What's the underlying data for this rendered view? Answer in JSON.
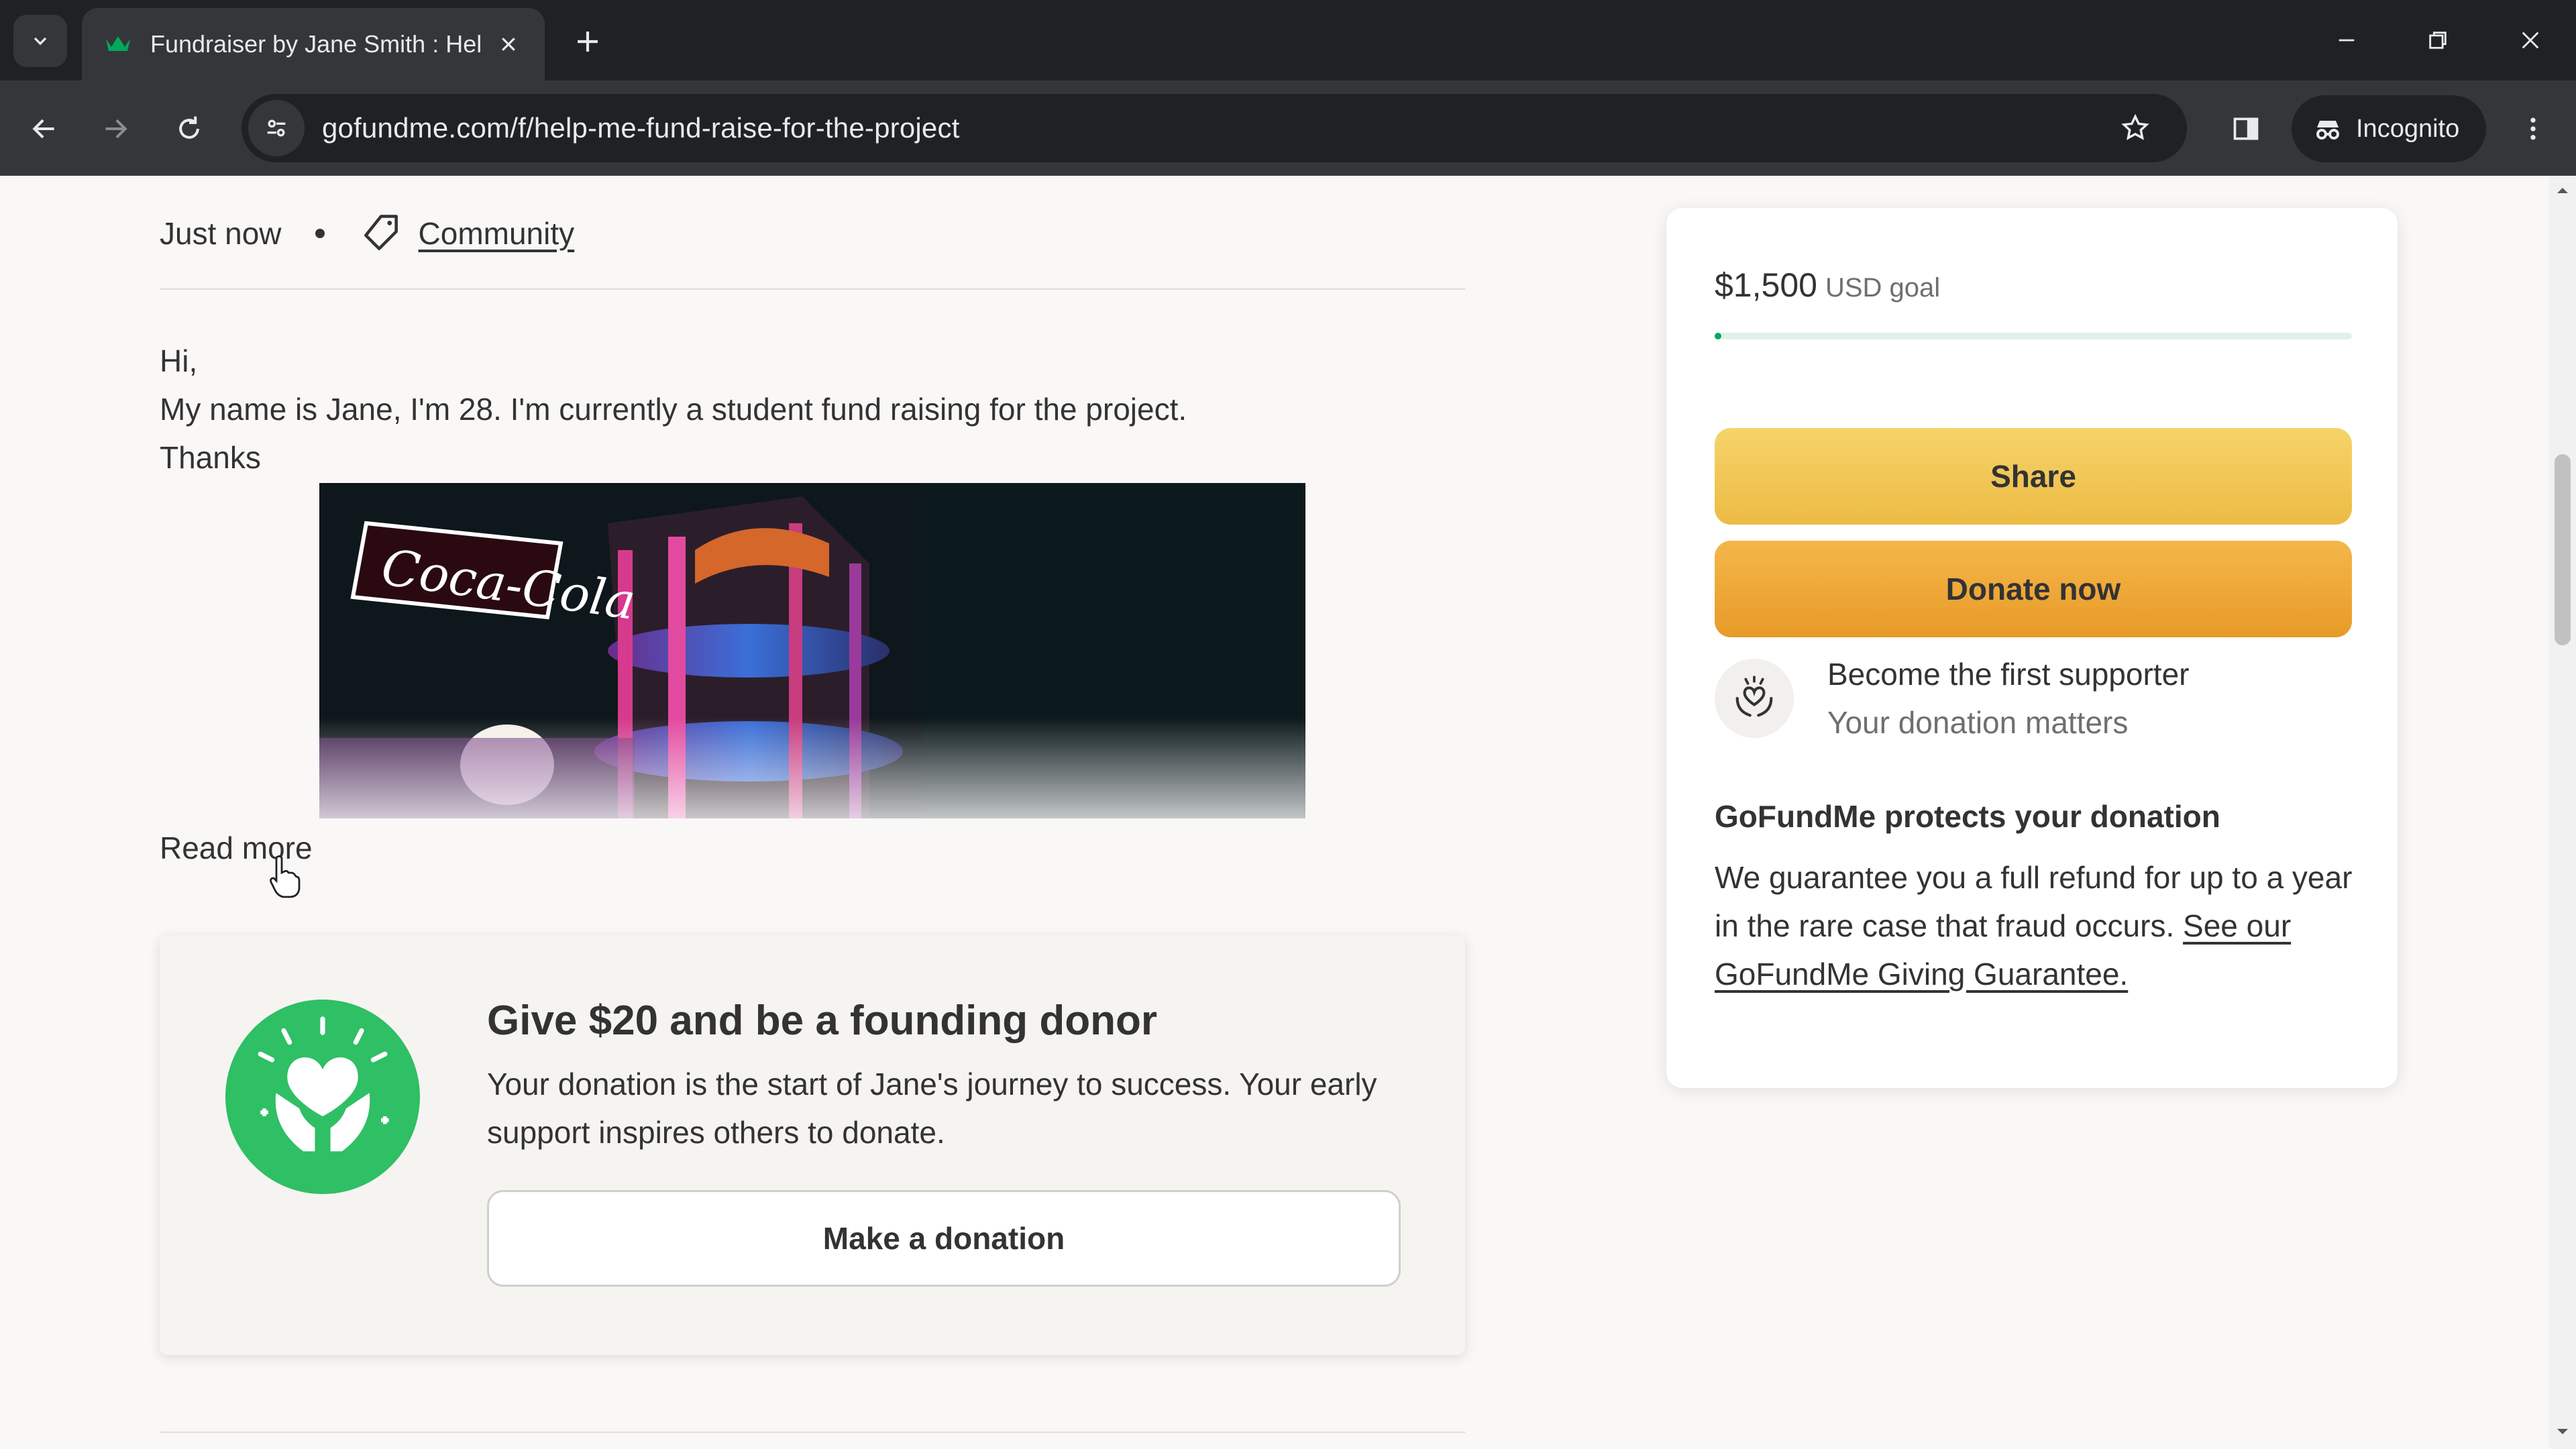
{
  "browser": {
    "tab_title": "Fundraiser by Jane Smith : Help",
    "url": "gofundme.com/f/help-me-fund-raise-for-the-project",
    "incognito_label": "Incognito"
  },
  "meta": {
    "time": "Just now",
    "category": "Community"
  },
  "story": {
    "lines": [
      "Hi,",
      "My name is Jane, I'm 28. I'm currently a student fund raising for the project.",
      "Thanks"
    ],
    "read_more": "Read more"
  },
  "founding": {
    "title": "Give $20 and be a founding donor",
    "description": "Your donation is the start of Jane's journey to success. Your early support inspires others to donate.",
    "button": "Make a donation"
  },
  "sidebar": {
    "goal_amount": "$1,500",
    "goal_suffix": "USD goal",
    "progress_fraction": 0.01,
    "share_button": "Share",
    "donate_button": "Donate now",
    "supporter_title": "Become the first supporter",
    "supporter_subtitle": "Your donation matters",
    "protect_title": "GoFundMe protects your donation",
    "protect_text": "We guarantee you a full refund for up to a year in the rare case that fraud occurs.",
    "protect_link": "See our GoFundMe Giving Guarantee."
  },
  "colors": {
    "brand_green": "#02a95c",
    "share_yellow": "#ecbb44",
    "donate_orange": "#e89a28"
  },
  "icons": {
    "tab_favicon": "gofundme-logo-icon",
    "category_icon": "tag-icon",
    "supporter_icon": "heart-hands-icon",
    "founding_badge": "heart-hands-badge-icon"
  }
}
